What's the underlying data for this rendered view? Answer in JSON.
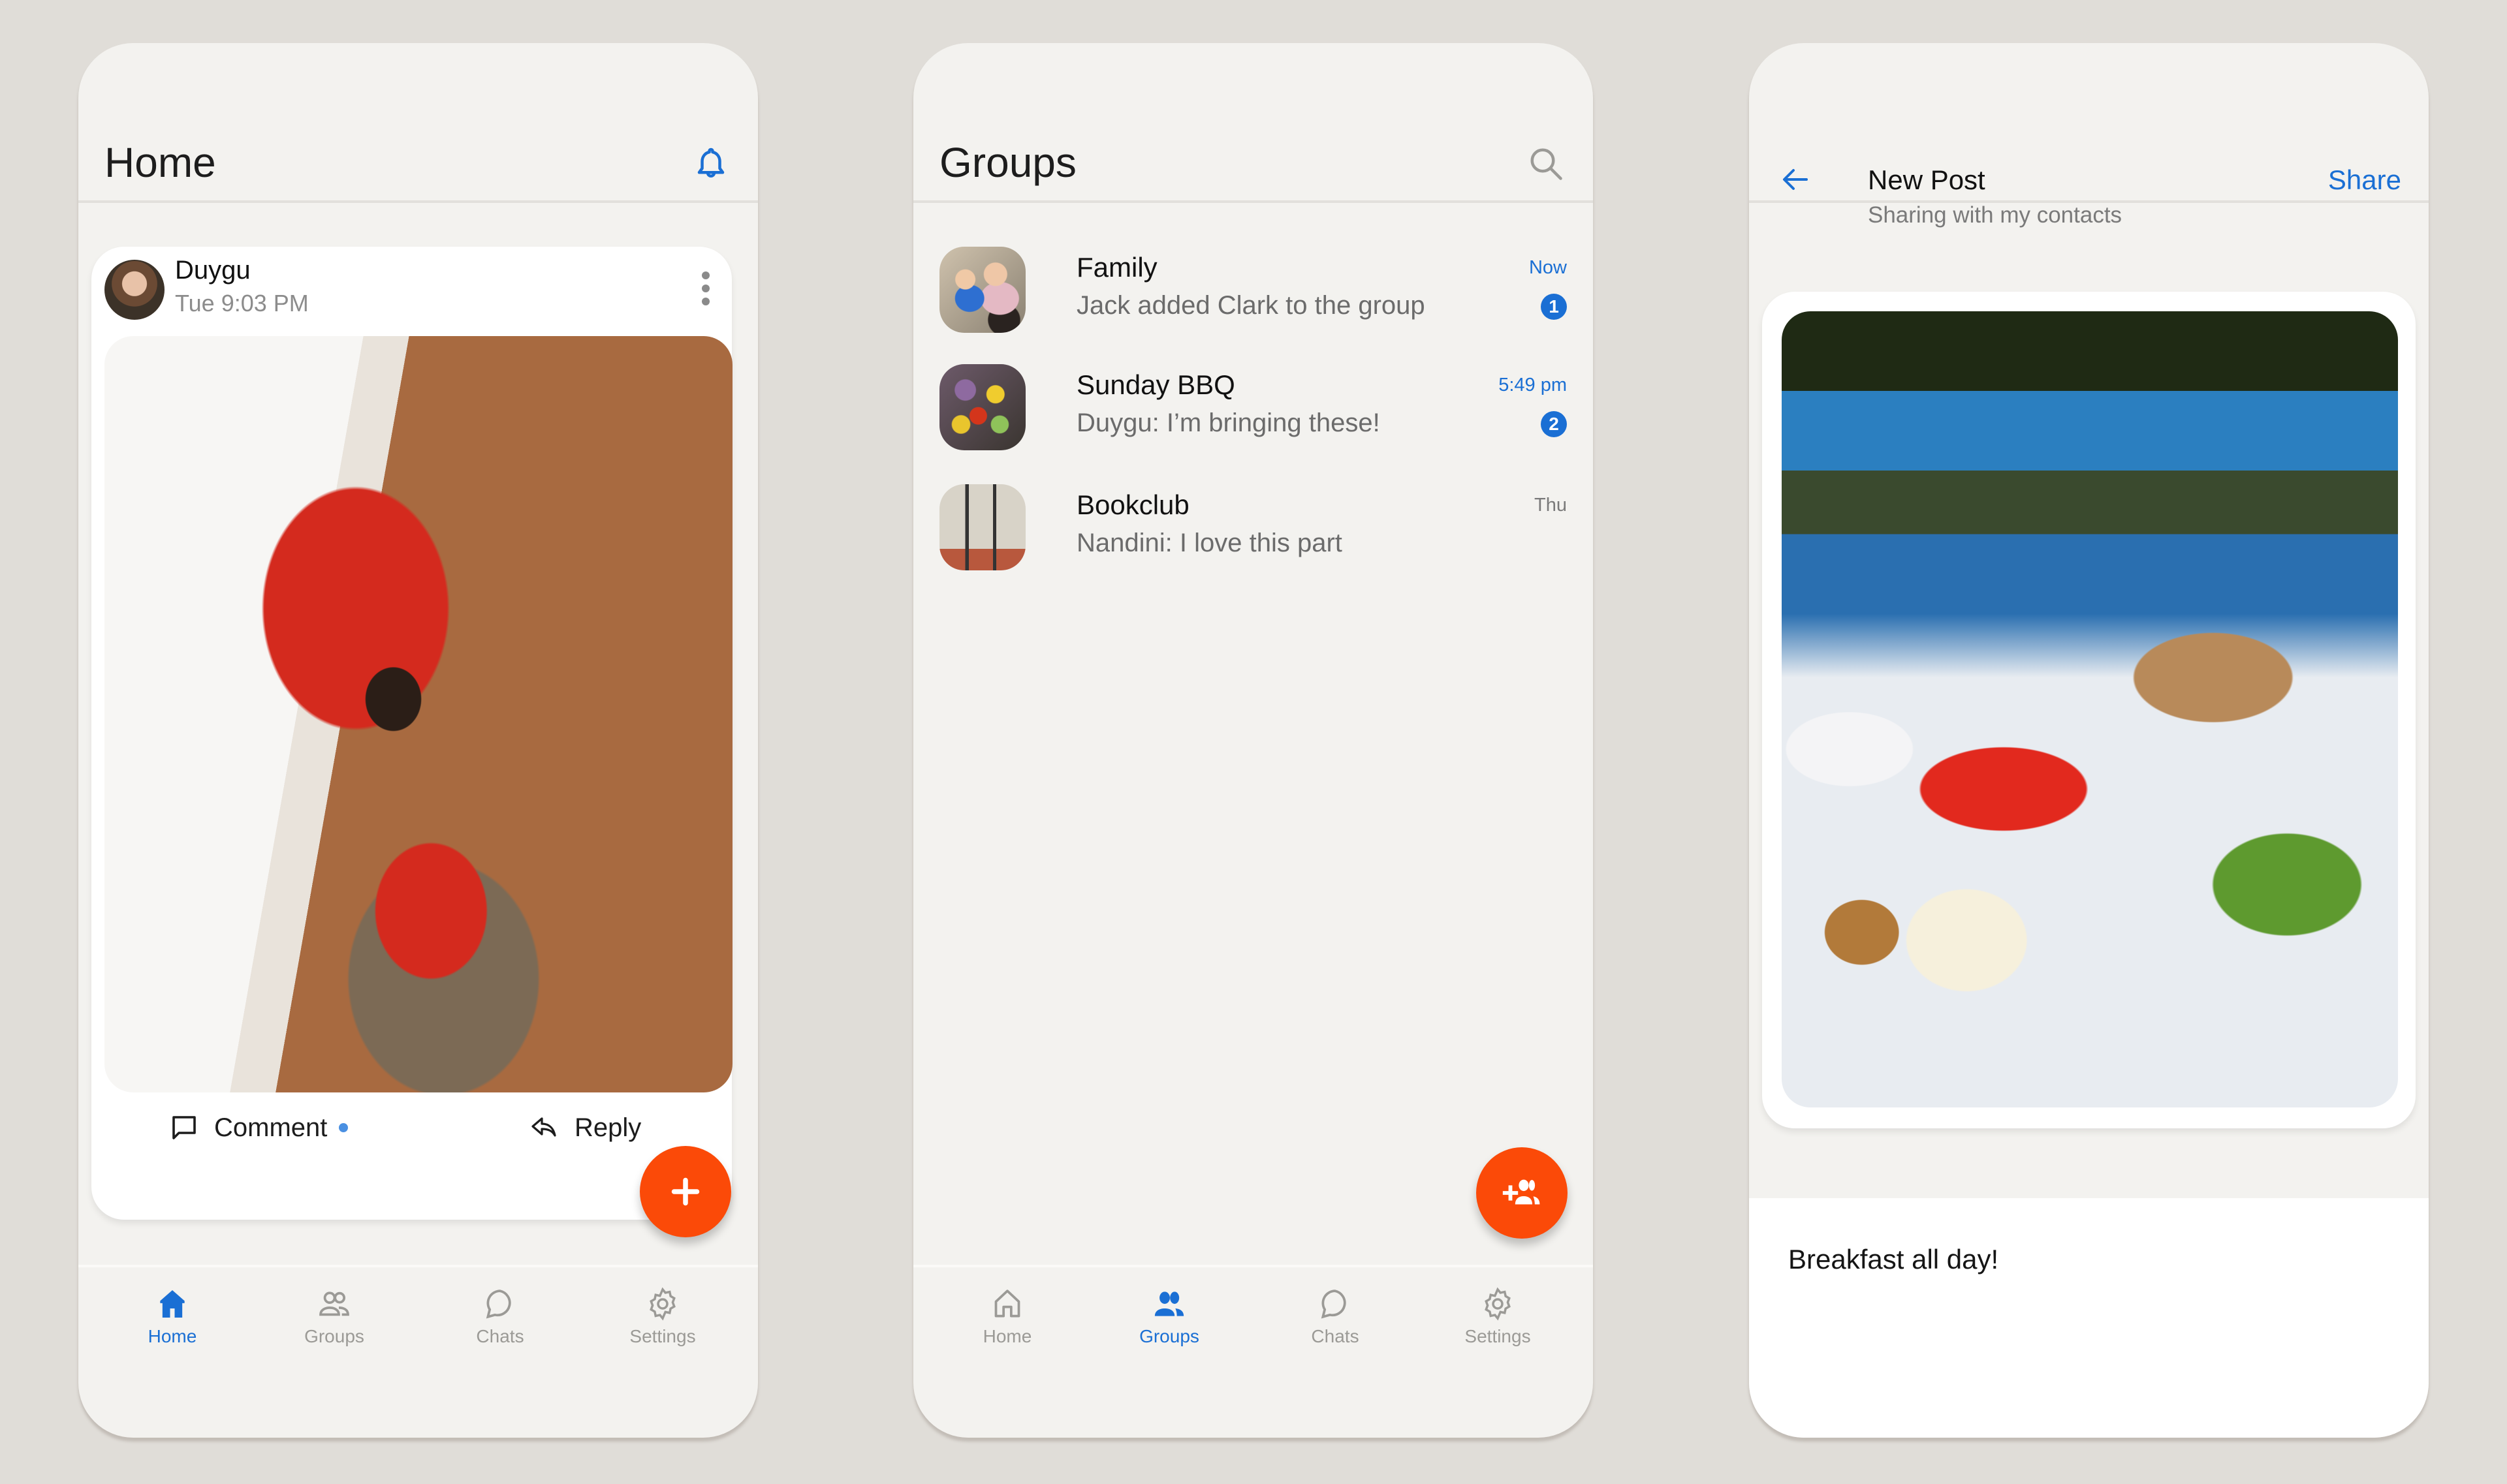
{
  "theme": {
    "accent": "#1a6fd4",
    "fab": "#fb4a08",
    "background": "#e0ddd8",
    "surface": "#f3f2ef"
  },
  "screens": {
    "home": {
      "title": "Home",
      "header_icon": "bell-icon",
      "post": {
        "author": "Duygu",
        "time": "Tue 9:03 PM",
        "more_icon": "more-vertical-icon",
        "photo_description": "Two children in red cat-print pajamas in a hallway, one sitting in a woven basket",
        "actions": [
          {
            "label": "Comment",
            "icon": "comment-icon",
            "has_unread_dot": true
          },
          {
            "label": "Reply",
            "icon": "reply-icon"
          }
        ]
      },
      "fab": {
        "icon": "plus-icon",
        "label": "New post"
      },
      "nav": [
        {
          "label": "Home",
          "icon": "home-icon",
          "active": true
        },
        {
          "label": "Groups",
          "icon": "groups-icon",
          "active": false
        },
        {
          "label": "Chats",
          "icon": "chat-icon",
          "active": false
        },
        {
          "label": "Settings",
          "icon": "gear-icon",
          "active": false
        }
      ]
    },
    "groups": {
      "title": "Groups",
      "header_icon": "search-icon",
      "items": [
        {
          "name": "Family",
          "message": "Jack added Clark to the group",
          "time": "Now",
          "unread": "1",
          "highlight": true
        },
        {
          "name": "Sunday BBQ",
          "message": "Duygu: I’m bringing these!",
          "time": "5:49 pm",
          "unread": "2",
          "highlight": true
        },
        {
          "name": "Bookclub",
          "message": "Nandini: I love this part",
          "time": "Thu",
          "unread": null,
          "highlight": false
        }
      ],
      "fab": {
        "icon": "add-group-icon",
        "label": "Add group"
      },
      "nav": [
        {
          "label": "Home",
          "icon": "home-icon",
          "active": false
        },
        {
          "label": "Groups",
          "icon": "groups-icon",
          "active": true
        },
        {
          "label": "Chats",
          "icon": "chat-icon",
          "active": false
        },
        {
          "label": "Settings",
          "icon": "gear-icon",
          "active": false
        }
      ]
    },
    "new_post": {
      "title": "New Post",
      "subtitle": "Sharing with my contacts",
      "back_icon": "back-arrow-icon",
      "share_label": "Share",
      "photo_description": "Outdoor breakfast table with cheese, walnuts, tomatoes, cucumbers and flatbread",
      "caption": "Breakfast all day!"
    }
  }
}
